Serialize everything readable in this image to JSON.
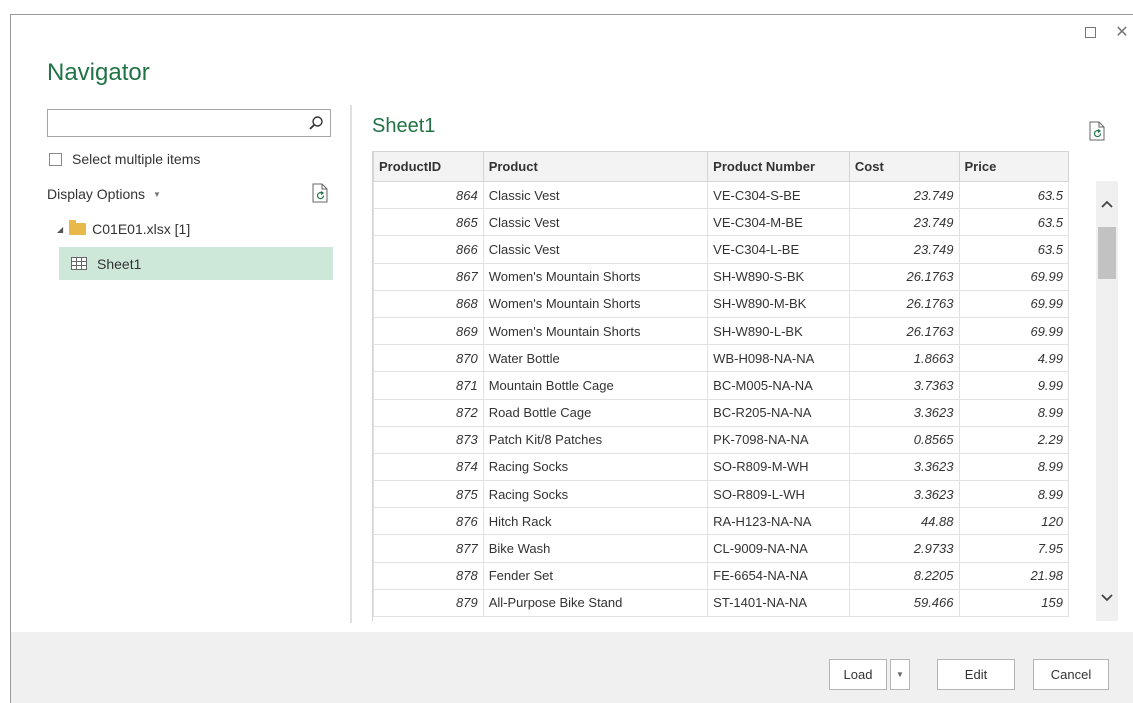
{
  "window": {
    "title": "Navigator"
  },
  "left_panel": {
    "search": {
      "value": "",
      "placeholder": ""
    },
    "select_multiple_label": "Select multiple items",
    "display_options_label": "Display Options",
    "tree": {
      "file_label": "C01E01.xlsx [1]",
      "sheet_label": "Sheet1"
    }
  },
  "preview": {
    "title": "Sheet1",
    "columns": [
      "ProductID",
      "Product",
      "Product Number",
      "Cost",
      "Price"
    ],
    "rows": [
      [
        "864",
        "Classic Vest",
        "VE-C304-S-BE",
        "23.749",
        "63.5"
      ],
      [
        "865",
        "Classic Vest",
        "VE-C304-M-BE",
        "23.749",
        "63.5"
      ],
      [
        "866",
        "Classic Vest",
        "VE-C304-L-BE",
        "23.749",
        "63.5"
      ],
      [
        "867",
        "Women's Mountain Shorts",
        "SH-W890-S-BK",
        "26.1763",
        "69.99"
      ],
      [
        "868",
        "Women's Mountain Shorts",
        "SH-W890-M-BK",
        "26.1763",
        "69.99"
      ],
      [
        "869",
        "Women's Mountain Shorts",
        "SH-W890-L-BK",
        "26.1763",
        "69.99"
      ],
      [
        "870",
        "Water Bottle",
        "WB-H098-NA-NA",
        "1.8663",
        "4.99"
      ],
      [
        "871",
        "Mountain Bottle Cage",
        "BC-M005-NA-NA",
        "3.7363",
        "9.99"
      ],
      [
        "872",
        "Road Bottle Cage",
        "BC-R205-NA-NA",
        "3.3623",
        "8.99"
      ],
      [
        "873",
        "Patch Kit/8 Patches",
        "PK-7098-NA-NA",
        "0.8565",
        "2.29"
      ],
      [
        "874",
        "Racing Socks",
        "SO-R809-M-WH",
        "3.3623",
        "8.99"
      ],
      [
        "875",
        "Racing Socks",
        "SO-R809-L-WH",
        "3.3623",
        "8.99"
      ],
      [
        "876",
        "Hitch Rack",
        "RA-H123-NA-NA",
        "44.88",
        "120"
      ],
      [
        "877",
        "Bike Wash",
        "CL-9009-NA-NA",
        "2.9733",
        "7.95"
      ],
      [
        "878",
        "Fender Set",
        "FE-6654-NA-NA",
        "8.2205",
        "21.98"
      ],
      [
        "879",
        "All-Purpose Bike Stand",
        "ST-1401-NA-NA",
        "59.466",
        "159"
      ]
    ]
  },
  "footer": {
    "load_label": "Load",
    "edit_label": "Edit",
    "cancel_label": "Cancel"
  },
  "colors": {
    "accent": "#217346",
    "selection": "#cde8d9",
    "footer_bg": "#f0f0f0"
  },
  "icons": {
    "search": "magnifier-icon",
    "refresh": "refresh-document-icon",
    "file": "folder-icon",
    "sheet": "table-grid-icon"
  }
}
